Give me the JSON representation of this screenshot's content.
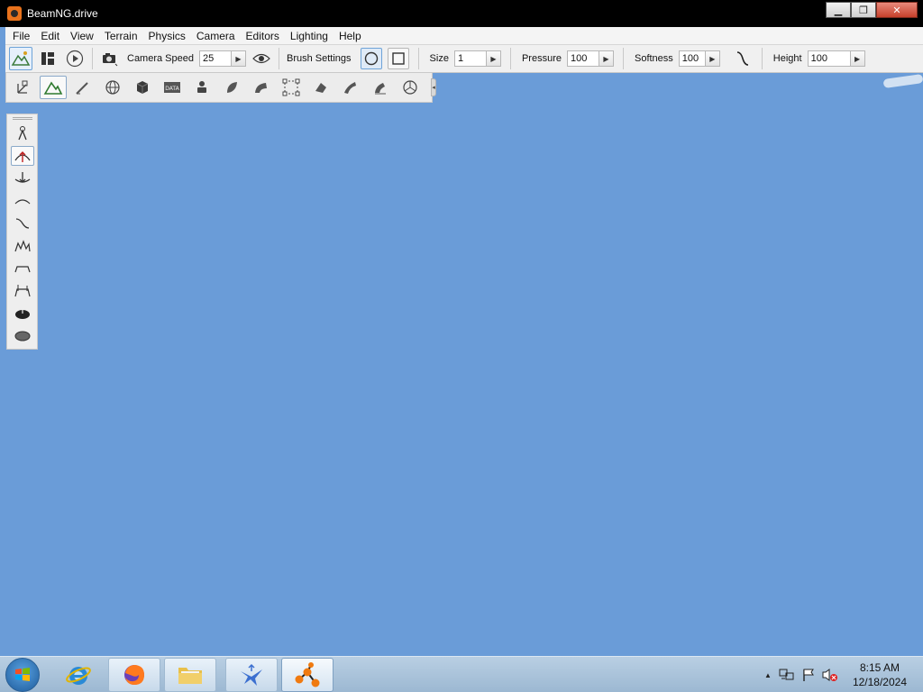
{
  "window": {
    "title": "BeamNG.drive",
    "minimize_glyph": "▁",
    "maximize_glyph": "❐",
    "close_glyph": "✕"
  },
  "menu": [
    "File",
    "Edit",
    "View",
    "Terrain",
    "Physics",
    "Camera",
    "Editors",
    "Lighting",
    "Help"
  ],
  "toolbar": {
    "camera_speed_label": "Camera Speed",
    "camera_speed_value": "25",
    "brush_settings_label": "Brush Settings",
    "size_label": "Size",
    "size_value": "1",
    "pressure_label": "Pressure",
    "pressure_value": "100",
    "softness_label": "Softness",
    "softness_value": "100",
    "height_label": "Height",
    "height_value": "100"
  },
  "taskbar": {
    "clock_time": "8:15 AM",
    "clock_date": "12/18/2024",
    "tray_arrow": "▲"
  },
  "colors": {
    "viewport_sky": "#6a9cd8",
    "titlebar": "#000000",
    "app_icon": "#e8721c"
  }
}
